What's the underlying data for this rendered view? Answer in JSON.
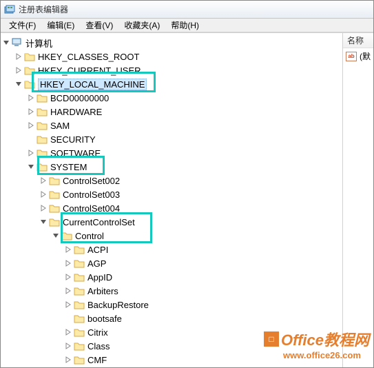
{
  "window": {
    "title": "注册表编辑器"
  },
  "menu": {
    "file": "文件(F)",
    "edit": "编辑(E)",
    "view": "查看(V)",
    "favorites": "收藏夹(A)",
    "help": "帮助(H)"
  },
  "right_pane": {
    "column_name": "名称",
    "default_value": "(默"
  },
  "tree": {
    "root": "计算机",
    "hkcr": "HKEY_CLASSES_ROOT",
    "hkcu": "HKEY_CURRENT_USER",
    "hklm": "HKEY_LOCAL_MACHINE",
    "hklm_children": {
      "bcd": "BCD00000000",
      "hardware": "HARDWARE",
      "sam": "SAM",
      "security": "SECURITY",
      "software": "SOFTWARE",
      "system": "SYSTEM"
    },
    "system_children": {
      "cs2": "ControlSet002",
      "cs3": "ControlSet003",
      "cs4": "ControlSet004",
      "ccs": "CurrentControlSet"
    },
    "ccs_children": {
      "control": "Control"
    },
    "control_children": {
      "acpi": "ACPI",
      "agp": "AGP",
      "appid": "AppID",
      "arbiters": "Arbiters",
      "backuprestore": "BackupRestore",
      "bootsafe": "bootsafe",
      "citrix": "Citrix",
      "class": "Class",
      "cmf": "CMF"
    }
  },
  "watermark": {
    "brand": "Office教程网",
    "url": "www.office26.com"
  }
}
